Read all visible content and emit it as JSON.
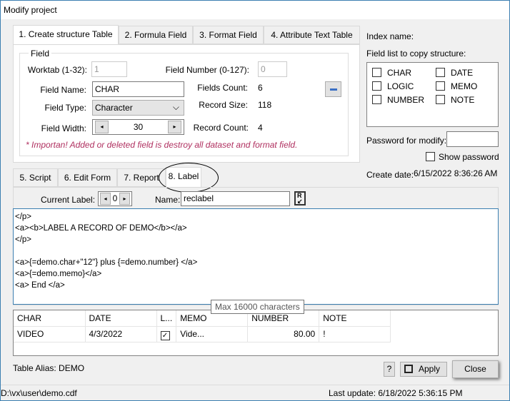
{
  "title": "Modify project",
  "tabs_top": [
    "1. Create structure Table",
    "2. Formula Field",
    "3. Format Field",
    "4. Attribute Text Table"
  ],
  "field_group": {
    "legend": "Field",
    "worktab_label": "Worktab (1-32):",
    "worktab_value": "1",
    "field_number_label": "Field Number (0-127):",
    "field_number_value": "0",
    "field_name_label": "Field Name:",
    "field_name_value": "CHAR",
    "fields_count_label": "Fields Count:",
    "fields_count_value": "6",
    "field_type_label": "Field Type:",
    "field_type_value": "Character",
    "record_size_label": "Record Size:",
    "record_size_value": "118",
    "field_width_label": "Field Width:",
    "field_width_value": "30",
    "record_count_label": "Record Count:",
    "record_count_value": "4",
    "warning": "* Importan! Added or deleted field is destroy all dataset and format field."
  },
  "right": {
    "index_name_label": "Index name:",
    "field_list_label": "Field list to copy structure:",
    "fields": [
      "CHAR",
      "DATE",
      "LOGIC",
      "MEMO",
      "NUMBER",
      "NOTE"
    ],
    "password_label": "Password for modify:",
    "show_password": "Show password",
    "create_date_label": "Create date:",
    "create_date_value": "6/15/2022 8:36:26 AM"
  },
  "tabs_bottom": [
    "5. Script",
    "6. Edit Form",
    "7. Report",
    "8. Label"
  ],
  "label_tab": {
    "current_label": "Current Label:",
    "current_value": "0",
    "name_label": "Name:",
    "name_value": "reclabel",
    "editor_lines": [
      "</p>",
      "<a><b>LABEL A RECORD OF DEMO</b></a>",
      "</p>",
      "",
      "<a>{=demo.char+\"12\"} plus {=demo.number} </a>",
      "<a>{=demo.memo}</a>",
      "<a> End </a>"
    ],
    "tooltip": "Max 16000 characters"
  },
  "grid": {
    "headers": [
      "CHAR",
      "DATE",
      "L...",
      "MEMO",
      "NUMBER",
      "NOTE"
    ],
    "rows": [
      [
        "VIDEO",
        "4/3/2022",
        "checked",
        "Vide...",
        "80.00",
        "!"
      ]
    ]
  },
  "table_alias": "Table Alias:  DEMO",
  "buttons": {
    "help": "?",
    "apply": "Apply",
    "close": "Close"
  },
  "status": {
    "path": "D:\\vx\\user\\demo.cdf",
    "last_update": "Last update:   6/18/2022 5:36:15 PM"
  },
  "colors": {
    "warning": "#b03060",
    "window_border": "#3c7fb1"
  }
}
